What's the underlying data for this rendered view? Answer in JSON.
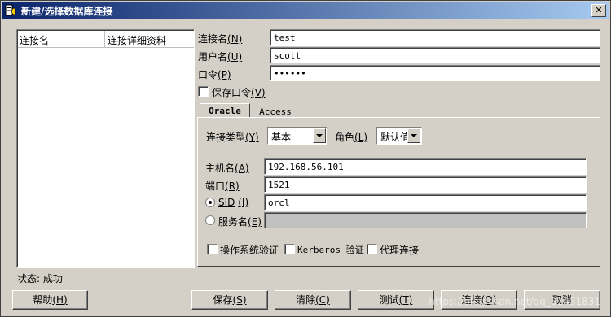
{
  "window": {
    "title": "新建/选择数据库连接",
    "close_glyph": "✕"
  },
  "list": {
    "columns": [
      "连接名",
      "连接详细资料"
    ]
  },
  "form": {
    "conn_name_label": "连接名",
    "conn_name_key": "(N)",
    "conn_name_value": "test",
    "user_label": "用户名",
    "user_key": "(U)",
    "user_value": "scott",
    "password_label": "口令",
    "password_key": "(P)",
    "password_value": "••••••",
    "save_password_label": "保存口令",
    "save_password_key": "(V)"
  },
  "tabs": [
    {
      "label": "Oracle",
      "active": true
    },
    {
      "label": "Access",
      "active": false
    }
  ],
  "oracle": {
    "conn_type_label": "连接类型",
    "conn_type_key": "(Y)",
    "conn_type_value": "基本",
    "role_label": "角色",
    "role_key": "(L)",
    "role_value": "默认值",
    "host_label": "主机名",
    "host_key": "(A)",
    "host_value": "192.168.56.101",
    "port_label": "端口",
    "port_key": "(R)",
    "port_value": "1521",
    "sid_label": "SID",
    "sid_key": "(I)",
    "sid_value": "orcl",
    "service_label": "服务名",
    "service_key": "(E)",
    "service_value": "",
    "os_auth_label": "操作系统验证",
    "kerberos_label": "Kerberos 验证",
    "proxy_label": "代理连接"
  },
  "status": {
    "text": "状态: 成功"
  },
  "buttons": {
    "help": "帮助",
    "help_key": "(H)",
    "save": "保存",
    "save_key": "(S)",
    "clear": "清除",
    "clear_key": "(C)",
    "test": "测试",
    "test_key": "(T)",
    "connect": "连接",
    "connect_key": "(O)",
    "cancel": "取消"
  },
  "watermark": "https://blog.csdn.net/qq_31481831"
}
